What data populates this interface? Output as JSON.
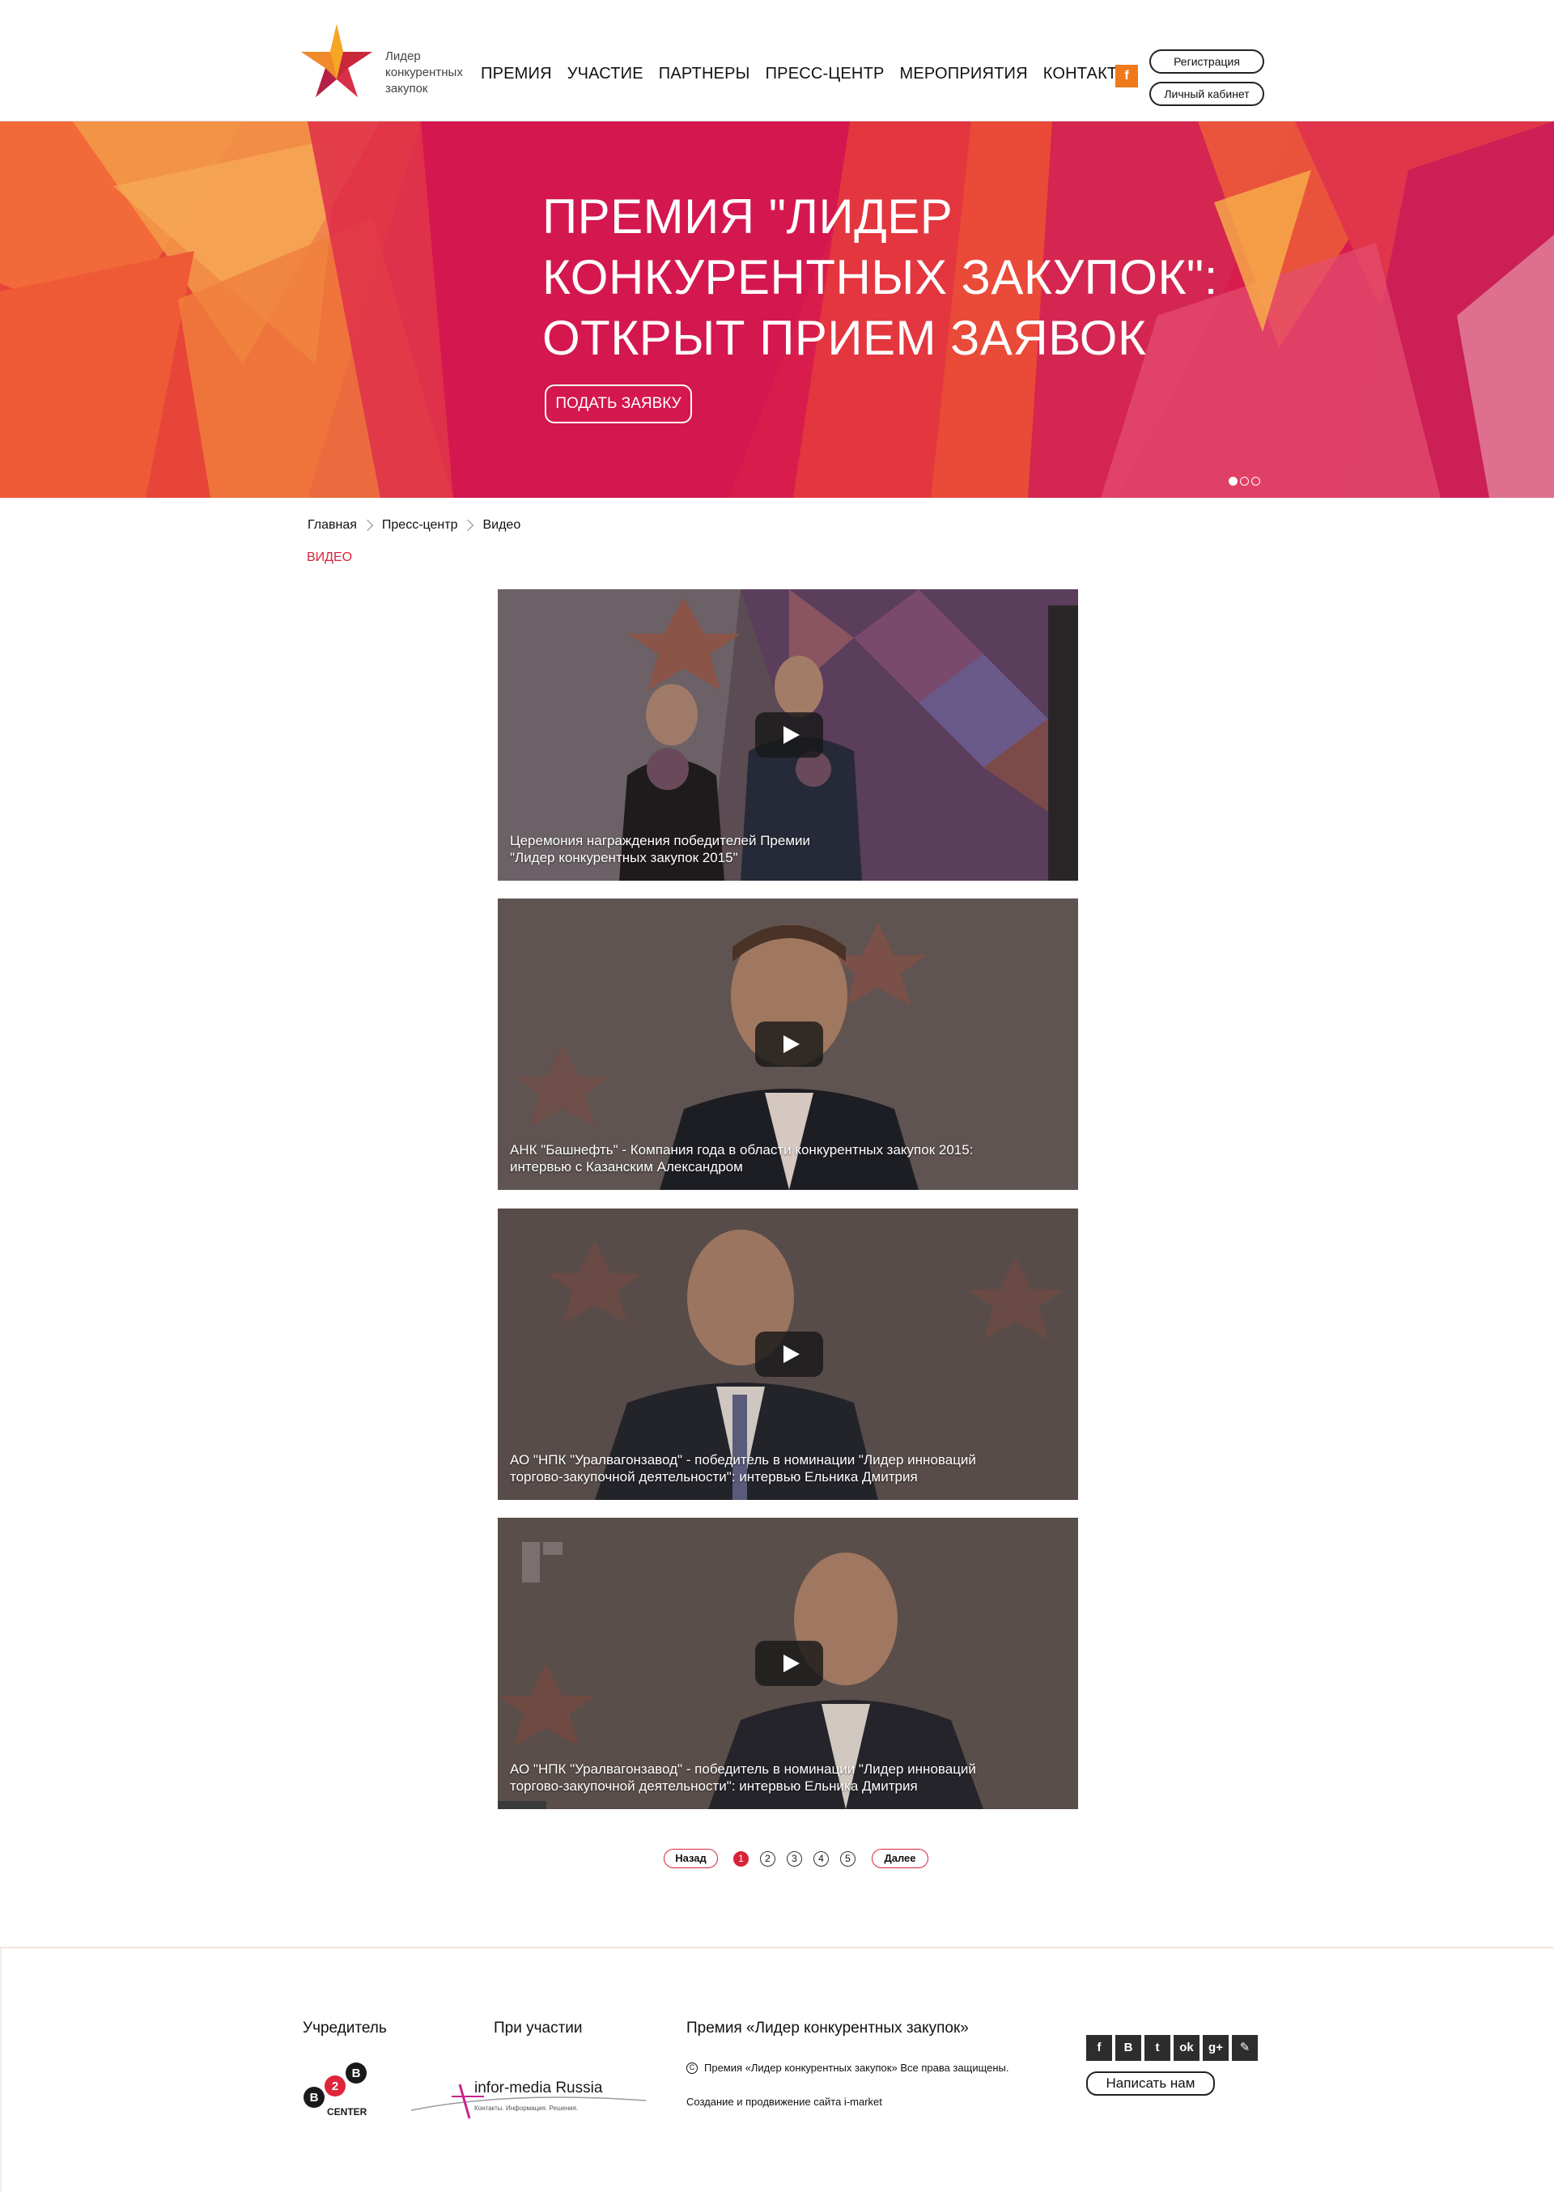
{
  "header": {
    "logo_lines": [
      "Лидер",
      "конкурентных",
      "закупок"
    ],
    "nav": [
      "ПРЕМИЯ",
      "УЧАСТИЕ",
      "ПАРТНЕРЫ",
      "ПРЕСС-ЦЕНТР",
      "МЕРОПРИЯТИЯ",
      "КОНТАКТЫ"
    ],
    "facebook_glyph": "f",
    "register_label": "Регистрация",
    "cabinet_label": "Личный кабинет"
  },
  "banner": {
    "title_lines": [
      "ПРЕМИЯ \"ЛИДЕР",
      "КОНКУРЕНТНЫХ ЗАКУПОК\":",
      "ОТКРЫТ ПРИЕМ ЗАЯВОК"
    ],
    "button_label": "ПОДАТЬ ЗАЯВКУ",
    "slide_count": 3,
    "active_slide": 1
  },
  "breadcrumb": [
    "Главная",
    "Пресс-центр",
    "Видео"
  ],
  "page_title": "ВИДЕО",
  "videos": [
    {
      "caption_lines": [
        "Церемония награждения победителей Премии",
        "\"Лидер конкурентных закупок 2015\""
      ]
    },
    {
      "caption_lines": [
        "АНК \"Башнефть\" - Компания года в области конкурентных закупок 2015:",
        "интервью с Казанским Александром"
      ]
    },
    {
      "caption_lines": [
        "АО \"НПК \"Уралвагонзавод\" - победитель в номинации \"Лидер инноваций",
        "торгово-закупочной деятельности\": интервью Ельника Дмитрия"
      ]
    },
    {
      "caption_lines": [
        "АО \"НПК \"Уралвагонзавод\" - победитель в номинации \"Лидер инноваций",
        "торгово-закупочной деятельности\": интервью Ельника Дмитрия"
      ]
    }
  ],
  "pagination": {
    "back_label": "Назад",
    "pages": [
      "1",
      "2",
      "3",
      "4",
      "5"
    ],
    "current_page": "1",
    "next_label": "Далее"
  },
  "footer": {
    "founder_heading": "Учредитель",
    "participation_heading": "При участии",
    "award_heading": "Премия «Лидер конкурентных закупок»",
    "b2b_logo_text": [
      "B",
      "2",
      "B",
      "CENTER"
    ],
    "infor_logo_text": "infor-media Russia",
    "infor_tagline": "Контакты. Информация. Решения.",
    "copyright_symbol": "C",
    "copyright": "Премия «Лидер конкурентных закупок» Все права защищены.",
    "made_by": "Создание и продвижение сайта i-market",
    "social_glyphs": [
      "f",
      "B",
      "t",
      "ok",
      "g+",
      "✎"
    ],
    "social_icons": [
      "facebook-icon",
      "vk-icon",
      "twitter-icon",
      "odnoklassniki-icon",
      "google-plus-icon",
      "livejournal-icon"
    ],
    "write_label": "Написать нам"
  },
  "colors": {
    "accent_red": "#d8243b",
    "banner_red": "#d91e4c",
    "facebook_orange": "#f07a1a"
  }
}
